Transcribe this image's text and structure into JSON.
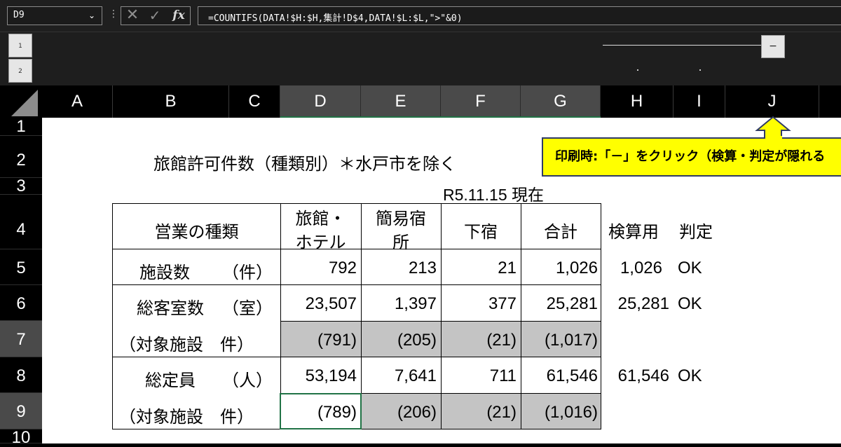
{
  "formula_bar": {
    "name_box": "D9",
    "name_box_arrow": "⌄",
    "menu_dots": "⋮",
    "cancel": "✕",
    "enter": "✓",
    "fx": "fx",
    "formula": "=COUNTIFS(DATA!$H:$H,集計!D$4,DATA!$L:$L,\">\"&0)"
  },
  "outline": {
    "levels": [
      "1",
      "2"
    ],
    "collapse_button": "−"
  },
  "columns": [
    "A",
    "B",
    "C",
    "D",
    "E",
    "F",
    "G",
    "H",
    "I",
    "J"
  ],
  "rows": [
    "1",
    "2",
    "3",
    "4",
    "5",
    "6",
    "7",
    "8",
    "9",
    "10"
  ],
  "sheet": {
    "title": "旅館許可件数（種類別）＊水戸市を除く",
    "as_of": "R5.11.15 現在",
    "header": {
      "type": "営業の種類",
      "ryokan_line1": "旅館・",
      "ryokan_line2": "ホテル",
      "kan_line1": "簡易宿",
      "kan_line2": "所",
      "geshuku": "下宿",
      "total": "合計",
      "check": "検算用",
      "judge": "判定"
    },
    "rows": {
      "r5": {
        "label": "施設数",
        "unit": "（件）",
        "d": "792",
        "e": "213",
        "f": "21",
        "g": "1,026",
        "h": "1,026",
        "i": "OK"
      },
      "r6": {
        "label": "総客室数",
        "unit": "（室）",
        "d": "23,507",
        "e": "1,397",
        "f": "377",
        "g": "25,281",
        "h": "25,281",
        "i": "OK"
      },
      "r7": {
        "label": "（対象施設　件）",
        "d": "(791)",
        "e": "(205)",
        "f": "(21)",
        "g": "(1,017)"
      },
      "r8": {
        "label": "総定員",
        "unit": "（人）",
        "d": "53,194",
        "e": "7,641",
        "f": "711",
        "g": "61,546",
        "h": "61,546",
        "i": "OK"
      },
      "r9": {
        "label": "（対象施設　件）",
        "d": "(789)",
        "e": "(206)",
        "f": "(21)",
        "g": "(1,016)"
      }
    }
  },
  "callout": "印刷時:「－」をクリック（検算・判定が隠れる",
  "colors": {
    "shade": "#c4c4c4",
    "callout_bg": "#ffff00",
    "selection": "#217346"
  }
}
